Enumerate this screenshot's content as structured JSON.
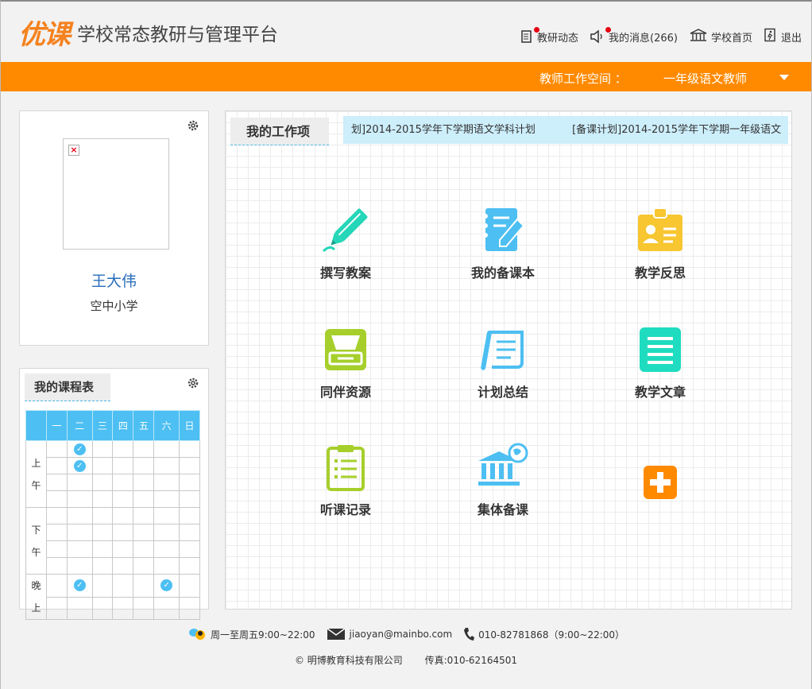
{
  "header": {
    "logo_text": "优课",
    "platform_title": "学校常态教研与管理平台",
    "nav": [
      {
        "label": "教研动态",
        "icon": "news-icon"
      },
      {
        "label": "我的消息(266)",
        "icon": "speaker-icon"
      },
      {
        "label": "学校首页",
        "icon": "school-icon"
      },
      {
        "label": "退出",
        "icon": "exit-icon"
      }
    ]
  },
  "workspace_bar": {
    "label": "教师工作空间 ：",
    "selected_role": "一年级语文教师",
    "color": "#ff8a00"
  },
  "profile": {
    "name": "王大伟",
    "school": "空中小学"
  },
  "schedule": {
    "title": "我的课程表",
    "days": [
      "一",
      "二",
      "三",
      "四",
      "五",
      "六",
      "日"
    ],
    "periods": [
      {
        "label": "上\n午",
        "rows": 4
      },
      {
        "label": "下\n午",
        "rows": 4
      },
      {
        "label": "晚\n上",
        "rows": 2
      }
    ],
    "checked": [
      {
        "row": 0,
        "day": 1
      },
      {
        "row": 1,
        "day": 1
      },
      {
        "row": 8,
        "day": 1
      },
      {
        "row": 8,
        "day": 5
      }
    ]
  },
  "work": {
    "title": "我的工作项",
    "ticker": [
      "划]2014-2015学年下学期语文学科计划",
      "[备课计划]2014-2015学年下学期一年级语文"
    ],
    "tiles": [
      {
        "label": "撰写教案",
        "icon": "pencil-icon"
      },
      {
        "label": "我的备课本",
        "icon": "notebook-icon"
      },
      {
        "label": "教学反思",
        "icon": "id-badge-icon"
      },
      {
        "label": "同伴资源",
        "icon": "inbox-icon"
      },
      {
        "label": "计划总结",
        "icon": "scroll-icon"
      },
      {
        "label": "教学文章",
        "icon": "document-icon"
      },
      {
        "label": "听课记录",
        "icon": "clipboard-icon"
      },
      {
        "label": "集体备课",
        "icon": "bank-globe-icon"
      },
      {
        "label": "",
        "icon": "add-icon"
      }
    ]
  },
  "footer": {
    "hours": "周一至周五9:00~22:00",
    "email": "jiaoyan@mainbo.com",
    "phone": "010-82781868（9:00~22:00）",
    "copyright": "© 明博教育科技有限公司",
    "fax": "传真:010-62164501"
  }
}
